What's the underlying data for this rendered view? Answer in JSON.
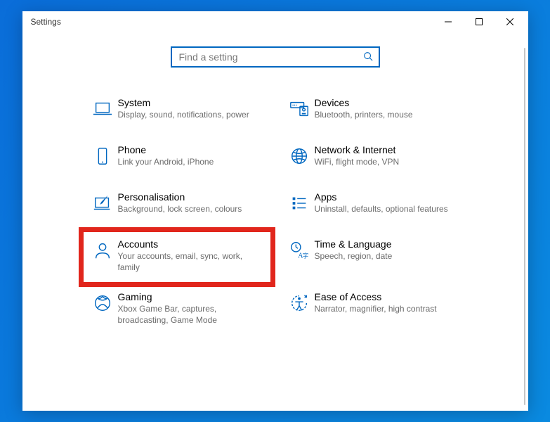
{
  "window": {
    "title": "Settings"
  },
  "search": {
    "placeholder": "Find a setting"
  },
  "categories": [
    {
      "key": "system",
      "title": "System",
      "desc": "Display, sound, notifications, power"
    },
    {
      "key": "devices",
      "title": "Devices",
      "desc": "Bluetooth, printers, mouse"
    },
    {
      "key": "phone",
      "title": "Phone",
      "desc": "Link your Android, iPhone"
    },
    {
      "key": "network",
      "title": "Network & Internet",
      "desc": "WiFi, flight mode, VPN"
    },
    {
      "key": "personalisation",
      "title": "Personalisation",
      "desc": "Background, lock screen, colours"
    },
    {
      "key": "apps",
      "title": "Apps",
      "desc": "Uninstall, defaults, optional features"
    },
    {
      "key": "accounts",
      "title": "Accounts",
      "desc": "Your accounts, email, sync, work, family"
    },
    {
      "key": "time",
      "title": "Time & Language",
      "desc": "Speech, region, date"
    },
    {
      "key": "gaming",
      "title": "Gaming",
      "desc": "Xbox Game Bar, captures, broadcasting, Game Mode"
    },
    {
      "key": "ease",
      "title": "Ease of Access",
      "desc": "Narrator, magnifier, high contrast"
    }
  ],
  "highlighted": "accounts"
}
